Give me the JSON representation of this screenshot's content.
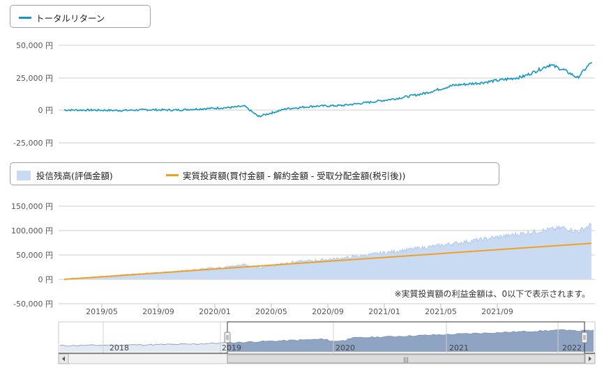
{
  "colors": {
    "return_line": "#1296c3",
    "balance_area": "#c9daf3",
    "balance_line": "#b3cbee",
    "invest_line": "#f0a020",
    "grid": "#cccccc",
    "navigator_area": "#b7c6dc",
    "navigator_selected": "#8fa3c2"
  },
  "legend_top": {
    "items": [
      {
        "label": "トータルリターン"
      }
    ]
  },
  "legend_bottom": {
    "items": [
      {
        "label": "投信残高(評価金額)"
      },
      {
        "label": "実質投資額(買付金額 - 解約金額 - 受取分配金額(税引後))"
      }
    ]
  },
  "note": "※実質投資額の利益金額は、0以下で表示されます。",
  "navigator": {
    "years": [
      "2018",
      "2019",
      "2020",
      "2021",
      "2022"
    ],
    "scroll_grip": "|||"
  },
  "chart_data": [
    {
      "type": "line",
      "series": [
        {
          "name": "トータルリターン",
          "x": [
            "2019/01",
            "2019/03",
            "2019/05",
            "2019/07",
            "2019/09",
            "2019/11",
            "2020/01",
            "2020/02",
            "2020/03",
            "2020/04",
            "2020/05",
            "2020/07",
            "2020/09",
            "2020/11",
            "2021/01",
            "2021/03",
            "2021/05",
            "2021/07",
            "2021/09",
            "2021/10",
            "2021/11",
            "2021/12",
            "2022/01",
            "2022/02",
            "2022/03"
          ],
          "values": [
            0,
            0,
            -300,
            200,
            0,
            1000,
            2000,
            3000,
            -5000,
            -2000,
            1000,
            3000,
            3500,
            6000,
            9000,
            13000,
            19000,
            21000,
            24000,
            25500,
            30000,
            35000,
            31000,
            25000,
            37000
          ]
        }
      ],
      "y_ticks": [
        "50,000 円",
        "25,000 円",
        "0 円",
        "-25,000 円"
      ],
      "ylim": [
        -25000,
        50000
      ],
      "grid": true
    },
    {
      "type": "area",
      "series": [
        {
          "name": "投信残高(評価金額)",
          "x": [
            "2019/01",
            "2019/05",
            "2019/09",
            "2020/01",
            "2020/02",
            "2020/03",
            "2020/05",
            "2020/09",
            "2021/01",
            "2021/05",
            "2021/09",
            "2021/11",
            "2022/01",
            "2022/02",
            "2022/03"
          ],
          "values": [
            0,
            8000,
            16000,
            26000,
            30000,
            24000,
            34000,
            43000,
            58000,
            73000,
            90000,
            98000,
            106000,
            98000,
            112000
          ]
        },
        {
          "name": "実質投資額(買付金額 - 解約金額 - 受取分配金額(税引後))",
          "x": [
            "2019/01",
            "2022/03"
          ],
          "values": [
            0,
            74000
          ]
        }
      ],
      "x_ticks": [
        "2019/05",
        "2019/09",
        "2020/01",
        "2020/05",
        "2020/09",
        "2021/01",
        "2021/05",
        "2021/09"
      ],
      "y_ticks": [
        "150,000 円",
        "100,000 円",
        "50,000 円",
        "0 円",
        "-50,000 円"
      ],
      "ylim": [
        -50000,
        150000
      ],
      "grid": true
    }
  ]
}
